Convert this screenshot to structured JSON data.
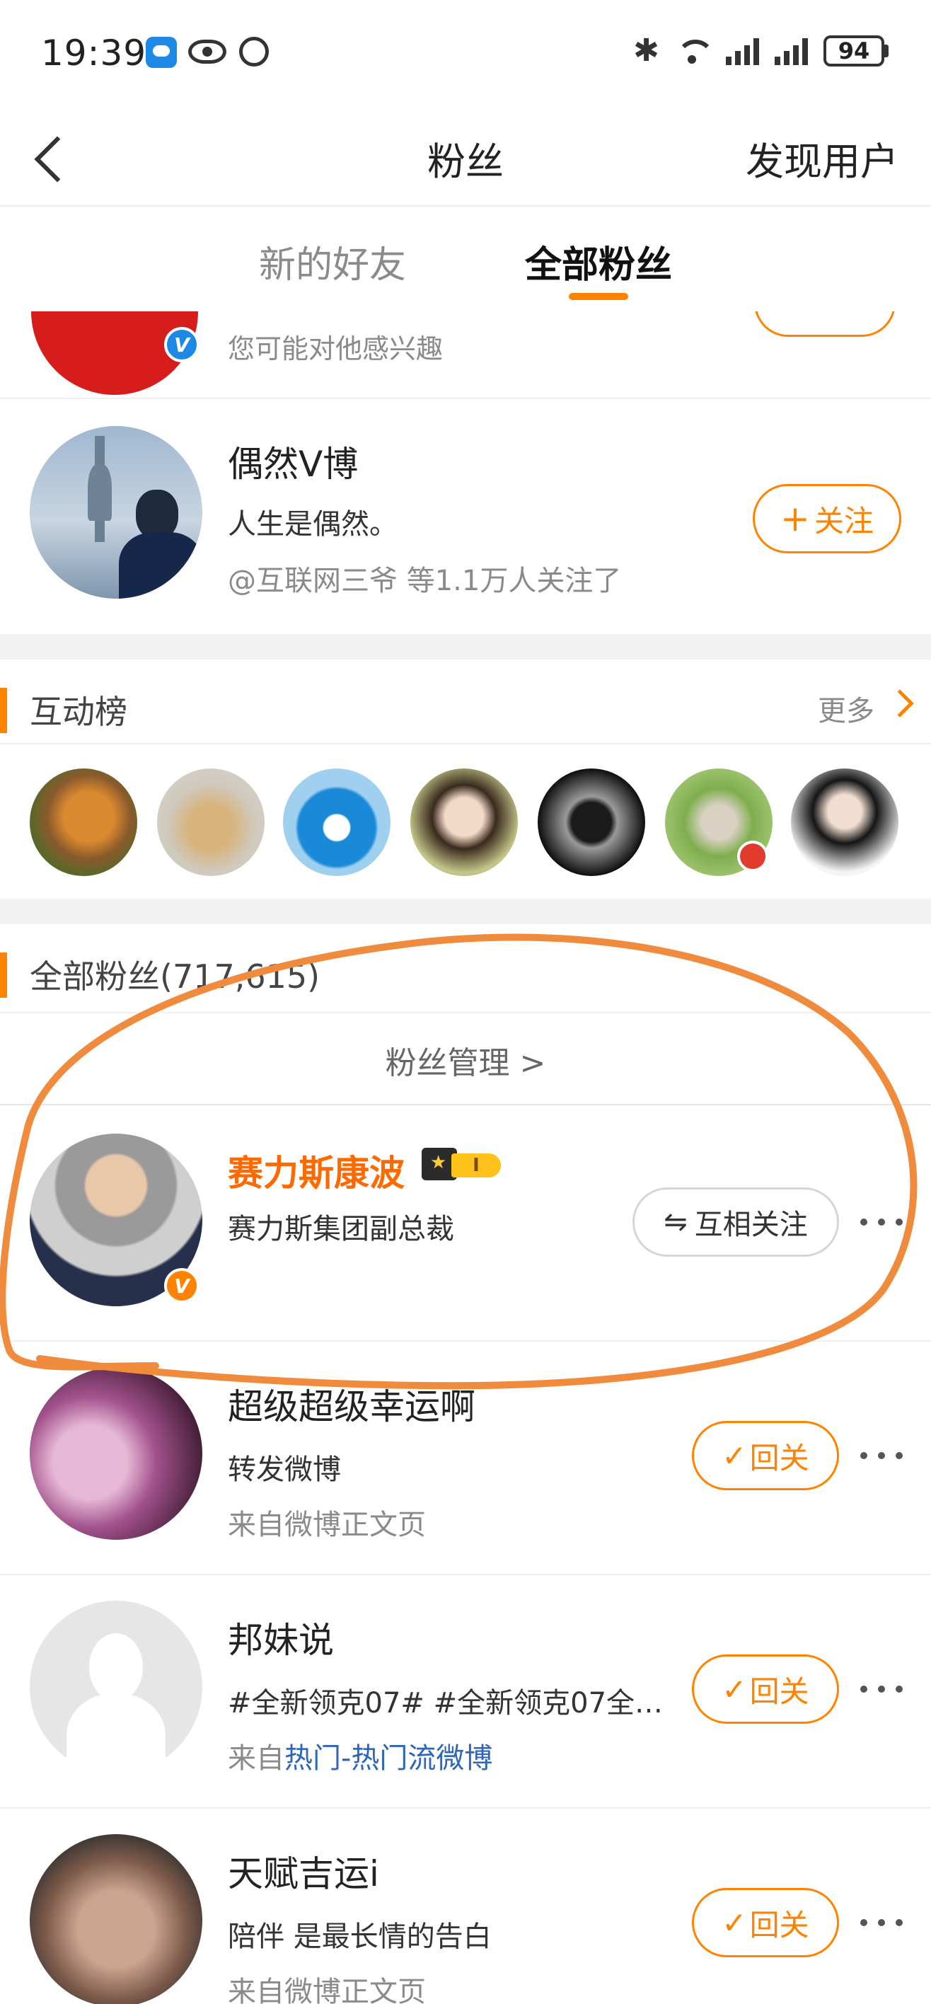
{
  "status_bar": {
    "time": "19:39",
    "bluetooth": "✱",
    "battery": "94",
    "icons": [
      "message-icon",
      "eye-icon",
      "alarm-icon",
      "bluetooth-icon",
      "wifi-icon",
      "signal-icon",
      "battery-icon"
    ]
  },
  "nav": {
    "title": "粉丝",
    "right_action": "发现用户"
  },
  "tabs": [
    {
      "label": "新的好友",
      "active": false
    },
    {
      "label": "全部粉丝",
      "active": true
    }
  ],
  "recommend": {
    "partial_item": {
      "subtitle": "您可能对他感兴趣"
    },
    "item": {
      "name": "偶然V博",
      "bio": "人生是偶然。",
      "followed_by": "@互联网三爷 等1.1万人关注了",
      "follow_plus": "+",
      "follow_label": "关注"
    }
  },
  "interaction_board": {
    "title": "互动榜",
    "more": "更多"
  },
  "all_fans": {
    "title": "全部粉丝(717,615)",
    "manage": "粉丝管理 >",
    "items": [
      {
        "name": "赛力斯康波",
        "bio": "赛力斯集团副总裁",
        "badge": "V",
        "vip_level": "I",
        "button_icon": "⇋",
        "button": "互相关注"
      },
      {
        "name": "超级超级幸运啊",
        "line1": "转发微博",
        "line2": "来自微博正文页",
        "button_icon": "✓",
        "button": "回关"
      },
      {
        "name": "邦妹说",
        "line1": "#全新领克07# #全新领克07全…",
        "line2_prefix": "来自",
        "line2_link": "热门-热门流微博",
        "button_icon": "✓",
        "button": "回关"
      },
      {
        "name": "天赋吉运i",
        "line1": "陪伴  是最长情的告白",
        "line2": "来自微博正文页",
        "button_icon": "✓",
        "button": "回关"
      }
    ]
  },
  "colors": {
    "accent": "#ff8200",
    "verified_blue": "#1e88e5",
    "link": "#2e66b8",
    "annotation": "#f08a3c"
  }
}
